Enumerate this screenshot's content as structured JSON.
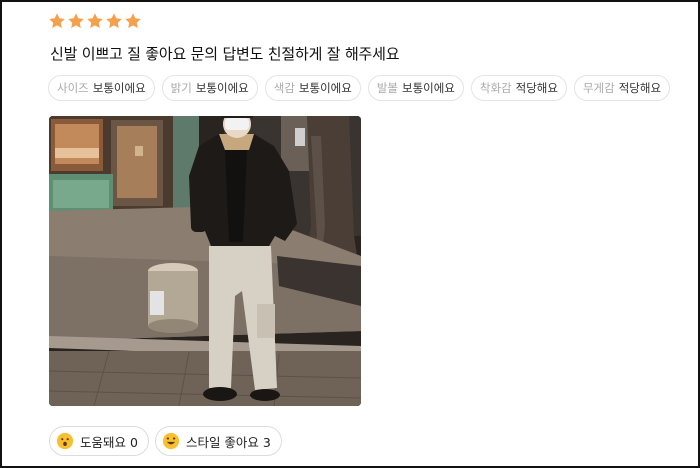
{
  "review": {
    "rating": 5,
    "max_rating": 5,
    "star_color": "#f5a04a",
    "text": "신발 이쁘고 질 좋아요 문의 답변도 친절하게 잘 해주세요",
    "tags": [
      {
        "key": "사이즈",
        "value": "보통이에요"
      },
      {
        "key": "밝기",
        "value": "보통이에요"
      },
      {
        "key": "색감",
        "value": "보통이에요"
      },
      {
        "key": "발볼",
        "value": "보통이에요"
      },
      {
        "key": "착화감",
        "value": "적당해요"
      },
      {
        "key": "무게감",
        "value": "적당해요"
      }
    ]
  },
  "photo": {
    "icon": "review-photo"
  },
  "reactions": [
    {
      "label": "도움돼요 0",
      "icon": "surprised-face-icon"
    },
    {
      "label": "스타일 좋아요 3",
      "icon": "grinning-face-icon"
    }
  ]
}
